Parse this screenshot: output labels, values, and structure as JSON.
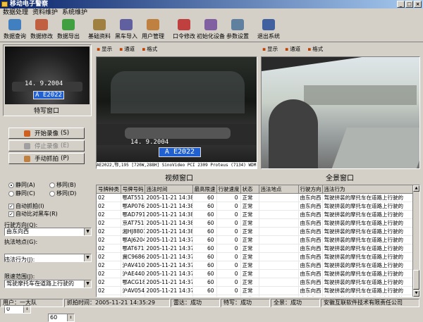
{
  "window": {
    "title": "移动电子警察"
  },
  "menu": [
    "数据处理",
    "资料维护",
    "系统维护"
  ],
  "toolbar": [
    {
      "label": "数据查询",
      "icon": "query-icon",
      "color": "#4080c0"
    },
    {
      "label": "数据修改",
      "icon": "edit-icon",
      "color": "#c06040"
    },
    {
      "label": "数据导出",
      "icon": "export-icon",
      "color": "#40a040"
    },
    {
      "label": "基础资料",
      "icon": "basic-data-icon",
      "color": "#a08040"
    },
    {
      "label": "黑车导入",
      "icon": "import-icon",
      "color": "#6060a0"
    },
    {
      "label": "用户管理",
      "icon": "users-icon",
      "color": "#c08040"
    },
    {
      "label": "口令修改",
      "icon": "key-icon",
      "color": "#c04040"
    },
    {
      "label": "初始化设备",
      "icon": "device-init-icon",
      "color": "#8060a0"
    },
    {
      "label": "参数设置",
      "icon": "settings-icon",
      "color": "#6080a0"
    },
    {
      "label": "退出系统",
      "icon": "exit-icon",
      "color": "#4060a0"
    }
  ],
  "feature_window": {
    "label": "特写窗口",
    "plate": "A E2022",
    "date": "14. 9.2004"
  },
  "video_window": {
    "label": "视频窗口",
    "header": [
      "显示",
      "通道",
      "格式"
    ],
    "plate": "A E2022",
    "date": "14. 9.2004",
    "caption": "AE2022,鄂,195 [720W,288H] SinoVideo PCI 2309 Proteus (7134) WDM"
  },
  "panorama_window": {
    "label": "全景窗口",
    "header": [
      "显示",
      "通道",
      "格式"
    ]
  },
  "controls": {
    "start_record": "开始录像",
    "start_hotkey": "(S)",
    "stop_record": "停止录像",
    "stop_hotkey": "(E)",
    "manual_capture": "手动抓拍",
    "manual_hotkey": "(P)",
    "mode_static_a": "静同(A)",
    "mode_motion_b": "移同(B)",
    "mode_static_c": "静同(C)",
    "mode_motion_d": "移同(D)",
    "auto_capture": "自动抓拍(I)",
    "auto_compare": "自动比对黑车(R)",
    "direction_label": "行驶方向(Q):",
    "direction_value": "由东向西",
    "location_label": "执法地点(G):",
    "location_value": "",
    "behavior_label": "违法行为(J):",
    "behavior_value": "驾驶摩托车在道路上行驶的",
    "speed_range_label": "限速范围(J):",
    "speed_from": "0",
    "speed_to": "60",
    "speed_dash": "--"
  },
  "table": {
    "columns": [
      "号牌种类",
      "号牌号码",
      "违法时间",
      "最高限速",
      "行驶速度",
      "状态",
      "违法地点",
      "行驶方向",
      "违法行为"
    ],
    "rows": [
      [
        "02",
        "鄂AT5516",
        "2005-11-21 14:38",
        "60",
        "0",
        "正常",
        "",
        "由东向西",
        "驾驶拼装的摩托车在道路上行驶的"
      ],
      [
        "02",
        "鄂AP0762",
        "2005-11-21 14:38",
        "60",
        "0",
        "正常",
        "",
        "由东向西",
        "驾驶拼装的摩托车在道路上行驶的"
      ],
      [
        "02",
        "鄂AD7915",
        "2005-11-21 14:38",
        "60",
        "0",
        "正常",
        "",
        "由东向西",
        "驾驶拼装的摩托车在道路上行驶的"
      ],
      [
        "02",
        "京AT7516",
        "2005-11-21 14:38",
        "60",
        "0",
        "正常",
        "",
        "由东向西",
        "驾驶拼装的摩托车在道路上行驶的"
      ],
      [
        "02",
        "湘HJ8801",
        "2005-11-21 14:38",
        "60",
        "0",
        "正常",
        "",
        "由东向西",
        "驾驶拼装的摩托车在道路上行驶的"
      ],
      [
        "02",
        "鄂AJ6204",
        "2005-11-21 14:37",
        "60",
        "0",
        "正常",
        "",
        "由东向西",
        "驾驶拼装的摩托车在道路上行驶的"
      ],
      [
        "02",
        "鄂AT6716",
        "2005-11-21 14:37",
        "60",
        "0",
        "正常",
        "",
        "由东向西",
        "驾驶拼装的摩托车在道路上行驶的"
      ],
      [
        "02",
        "冀C96867",
        "2005-11-21 14:37",
        "60",
        "0",
        "正常",
        "",
        "由东向西",
        "驾驶拼装的摩托车在道路上行驶的"
      ],
      [
        "02",
        "沪AV4100",
        "2005-11-21 14:37",
        "60",
        "0",
        "正常",
        "",
        "由东向西",
        "驾驶拼装的摩托车在道路上行驶的"
      ],
      [
        "02",
        "沪AE4405",
        "2005-11-21 14:37",
        "60",
        "0",
        "正常",
        "",
        "由东向西",
        "驾驶拼装的摩托车在道路上行驶的"
      ],
      [
        "02",
        "鄂ACG181",
        "2005-11-21 14:37",
        "60",
        "0",
        "正常",
        "",
        "由东向西",
        "驾驶拼装的摩托车在道路上行驶的"
      ],
      [
        "02",
        "沪AV0547",
        "2005-11-21 14:37",
        "60",
        "0",
        "正常",
        "",
        "由东向西",
        "驾驶拼装的摩托车在道路上行驶的"
      ],
      [
        "02",
        "沪AH1388",
        "2005-11-21 14:37",
        "60",
        "0",
        "正常",
        "",
        "由东向西",
        "驾驶拼装的摩托车在道路上行驶的"
      ],
      [
        "02",
        "沪AK7847",
        "2005-11-21 14:37",
        "60",
        "0",
        "正常",
        "",
        "由东向西",
        "驾驶拼装的摩托车在道路上行驶的"
      ]
    ]
  },
  "status": {
    "user": "用户：一大队",
    "capture_time": "抓拍时间：2005-11-21 14:35:29",
    "radar": "雷达：成功",
    "feature": "特写：成功",
    "panorama": "全景：成功",
    "company": "安徽互联软件技术有限责任公司"
  }
}
